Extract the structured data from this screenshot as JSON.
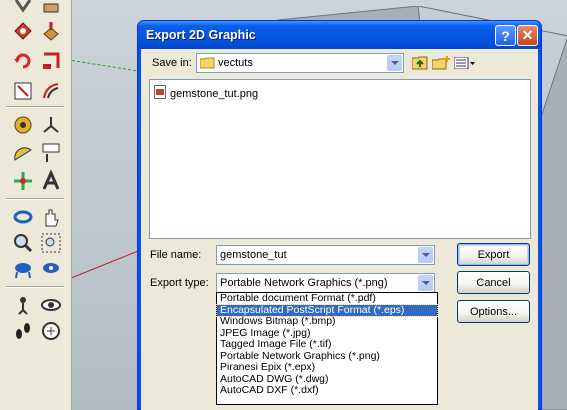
{
  "dialog": {
    "title": "Export 2D Graphic",
    "help_label": "?",
    "close_label": "✕"
  },
  "save_in": {
    "label": "Save in:",
    "value": "vectuts"
  },
  "files": [
    {
      "name": "gemstone_tut.png"
    }
  ],
  "file_name": {
    "label": "File name:",
    "value": "gemstone_tut"
  },
  "export_type": {
    "label": "Export type:",
    "value": "Portable Network Graphics (*.png)",
    "options": [
      "Portable document Format (*.pdf)",
      "Encapsulated PostScript Format (*.eps)",
      "Windows Bitmap (*.bmp)",
      "JPEG Image (*.jpg)",
      "Tagged Image File (*.tif)",
      "Portable Network Graphics (*.png)",
      "Piranesi Epix (*.epx)",
      "AutoCAD DWG (*.dwg)",
      "AutoCAD DXF (*.dxf)"
    ],
    "highlighted_option": "Encapsulated PostScript Format (*.eps)"
  },
  "buttons": {
    "export": "Export",
    "cancel": "Cancel",
    "options": "Options..."
  },
  "colors": {
    "title_bar": "#0554e0",
    "selection": "#316ac5",
    "dialog_face": "#ece9d8"
  },
  "toolbar_icons": [
    "line-icon",
    "push-pull-icon",
    "eraser-icon",
    "paint-bucket-icon",
    "rotate-icon",
    "follow-me-icon",
    "rectangle-select-icon",
    "offset-icon",
    "tape-measure-icon",
    "axes-icon",
    "protractor-icon",
    "dimension-text-icon",
    "move-icon",
    "3d-text-icon",
    "orbit-icon",
    "pan-icon",
    "zoom-icon",
    "zoom-window-icon",
    "walk-icon",
    "look-around-icon",
    "position-camera-icon",
    "section-plane-icon",
    "previous-view-icon",
    "next-view-icon"
  ]
}
